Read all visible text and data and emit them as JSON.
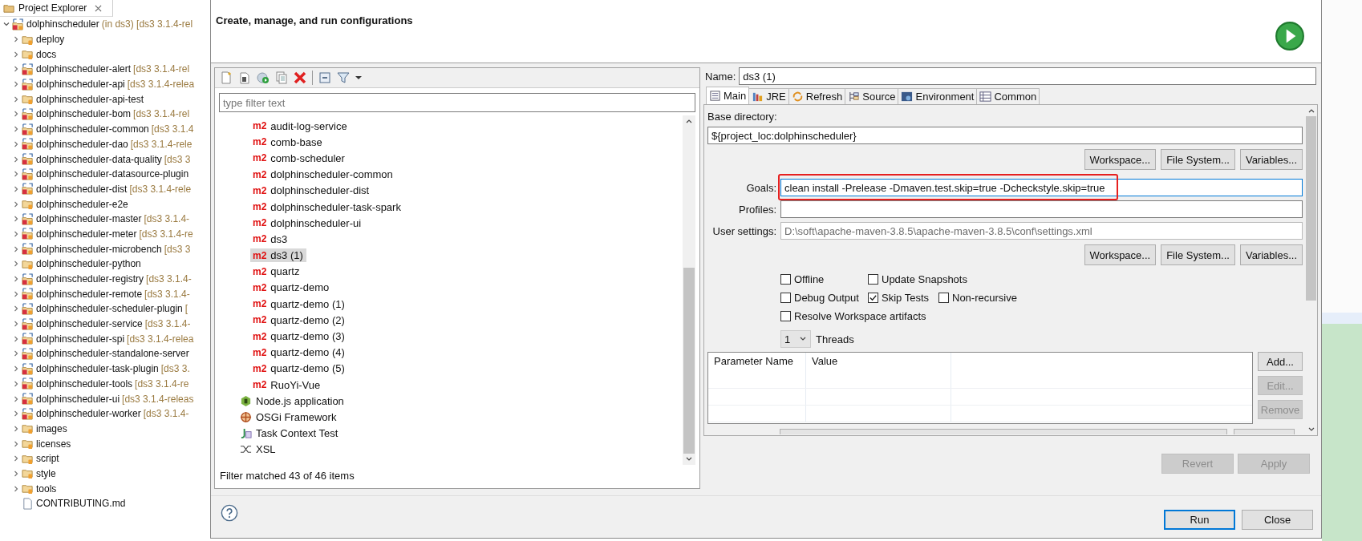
{
  "explorer": {
    "title": "Project Explorer",
    "tree": [
      {
        "name": "dolphinscheduler",
        "decoration": "(in ds3) [ds3 3.1.4-rel",
        "kind": "project",
        "expanded": true,
        "children": [
          {
            "name": "deploy",
            "kind": "folder",
            "expanded": false
          },
          {
            "name": "docs",
            "kind": "folder",
            "expanded": false
          },
          {
            "name": "dolphinscheduler-alert",
            "decoration": "[ds3 3.1.4-rel",
            "kind": "project",
            "expanded": false
          },
          {
            "name": "dolphinscheduler-api",
            "decoration": "[ds3 3.1.4-relea",
            "kind": "project",
            "expanded": false
          },
          {
            "name": "dolphinscheduler-api-test",
            "kind": "folder",
            "expanded": false
          },
          {
            "name": "dolphinscheduler-bom",
            "decoration": "[ds3 3.1.4-rel",
            "kind": "project",
            "expanded": false
          },
          {
            "name": "dolphinscheduler-common",
            "decoration": "[ds3 3.1.4",
            "kind": "project",
            "expanded": false
          },
          {
            "name": "dolphinscheduler-dao",
            "decoration": "[ds3 3.1.4-rele",
            "kind": "project",
            "expanded": false
          },
          {
            "name": "dolphinscheduler-data-quality",
            "decoration": "[ds3 3",
            "kind": "project",
            "expanded": false
          },
          {
            "name": "dolphinscheduler-datasource-plugin",
            "kind": "project",
            "expanded": false
          },
          {
            "name": "dolphinscheduler-dist",
            "decoration": "[ds3 3.1.4-rele",
            "kind": "project",
            "expanded": false
          },
          {
            "name": "dolphinscheduler-e2e",
            "kind": "folder",
            "expanded": false
          },
          {
            "name": "dolphinscheduler-master",
            "decoration": "[ds3 3.1.4-",
            "kind": "project",
            "expanded": false
          },
          {
            "name": "dolphinscheduler-meter",
            "decoration": "[ds3 3.1.4-re",
            "kind": "project",
            "expanded": false
          },
          {
            "name": "dolphinscheduler-microbench",
            "decoration": "[ds3 3",
            "kind": "project",
            "expanded": false
          },
          {
            "name": "dolphinscheduler-python",
            "kind": "folder",
            "expanded": false
          },
          {
            "name": "dolphinscheduler-registry",
            "decoration": "[ds3 3.1.4-",
            "kind": "project",
            "expanded": false
          },
          {
            "name": "dolphinscheduler-remote",
            "decoration": "[ds3 3.1.4-",
            "kind": "project",
            "expanded": false
          },
          {
            "name": "dolphinscheduler-scheduler-plugin",
            "decoration": "[",
            "kind": "project",
            "expanded": false
          },
          {
            "name": "dolphinscheduler-service",
            "decoration": "[ds3 3.1.4-",
            "kind": "project",
            "expanded": false
          },
          {
            "name": "dolphinscheduler-spi",
            "decoration": "[ds3 3.1.4-relea",
            "kind": "project",
            "expanded": false
          },
          {
            "name": "dolphinscheduler-standalone-server",
            "kind": "project",
            "expanded": false
          },
          {
            "name": "dolphinscheduler-task-plugin",
            "decoration": "[ds3 3.",
            "kind": "project",
            "expanded": false
          },
          {
            "name": "dolphinscheduler-tools",
            "decoration": "[ds3 3.1.4-re",
            "kind": "project",
            "expanded": false
          },
          {
            "name": "dolphinscheduler-ui",
            "decoration": "[ds3 3.1.4-releas",
            "kind": "project",
            "expanded": false
          },
          {
            "name": "dolphinscheduler-worker",
            "decoration": "[ds3 3.1.4-",
            "kind": "project",
            "expanded": false
          },
          {
            "name": "images",
            "kind": "folder",
            "expanded": false
          },
          {
            "name": "licenses",
            "kind": "folder",
            "expanded": false
          },
          {
            "name": "script",
            "kind": "folder",
            "expanded": false
          },
          {
            "name": "style",
            "kind": "folder",
            "expanded": false
          },
          {
            "name": "tools",
            "kind": "folder",
            "expanded": false
          },
          {
            "name": "CONTRIBUTING.md",
            "kind": "file"
          }
        ]
      }
    ]
  },
  "dialog": {
    "heading": "Create, manage, and run configurations",
    "filter": {
      "placeholder": "type filter text"
    },
    "launch_tree": [
      {
        "children": [
          {
            "badge": "m2",
            "label": "audit-log-service",
            "selected": false
          },
          {
            "badge": "m2",
            "label": "comb-base",
            "selected": false
          },
          {
            "badge": "m2",
            "label": "comb-scheduler",
            "selected": false
          },
          {
            "badge": "m2",
            "label": "dolphinscheduler-common",
            "selected": false
          },
          {
            "badge": "m2",
            "label": "dolphinscheduler-dist",
            "selected": false
          },
          {
            "badge": "m2",
            "label": "dolphinscheduler-task-spark",
            "selected": false
          },
          {
            "badge": "m2",
            "label": "dolphinscheduler-ui",
            "selected": false
          },
          {
            "badge": "m2",
            "label": "ds3",
            "selected": false
          },
          {
            "badge": "m2",
            "label": "ds3 (1)",
            "selected": true
          },
          {
            "badge": "m2",
            "label": "quartz",
            "selected": false
          },
          {
            "badge": "m2",
            "label": "quartz-demo",
            "selected": false
          },
          {
            "badge": "m2",
            "label": "quartz-demo (1)",
            "selected": false
          },
          {
            "badge": "m2",
            "label": "quartz-demo (2)",
            "selected": false
          },
          {
            "badge": "m2",
            "label": "quartz-demo (3)",
            "selected": false
          },
          {
            "badge": "m2",
            "label": "quartz-demo (4)",
            "selected": false
          },
          {
            "badge": "m2",
            "label": "quartz-demo (5)",
            "selected": false
          },
          {
            "badge": "m2",
            "label": "RuoYi-Vue",
            "selected": false
          }
        ]
      },
      {
        "label": "Node.js application",
        "kind": "nodejs",
        "selected": false
      },
      {
        "label": "OSGi Framework",
        "kind": "osgi",
        "selected": false
      },
      {
        "label": "Task Context Test",
        "kind": "junit",
        "selected": false
      },
      {
        "label": "XSL",
        "kind": "xsl",
        "selected": false
      }
    ],
    "filter_status": "Filter matched 43 of 46 items",
    "config": {
      "name_label": "Name:",
      "name": "ds3 (1)",
      "tabs": [
        {
          "label": "Main",
          "kind": "main",
          "selected": true
        },
        {
          "label": "JRE",
          "kind": "jre",
          "selected": false
        },
        {
          "label": "Refresh",
          "kind": "refresh",
          "selected": false
        },
        {
          "label": "Source",
          "kind": "source",
          "selected": false
        },
        {
          "label": "Environment",
          "kind": "environment",
          "selected": false
        },
        {
          "label": "Common",
          "kind": "common",
          "selected": false
        }
      ],
      "base_directory": {
        "label": "Base directory:",
        "value": "${project_loc:dolphinscheduler}"
      },
      "buttons_1": [
        "Workspace...",
        "File System...",
        "Variables..."
      ],
      "goals": {
        "label": "Goals:",
        "value": "clean install -Prelease -Dmaven.test.skip=true -Dcheckstyle.skip=true",
        "highlighted": true
      },
      "profiles": {
        "label": "Profiles:"
      },
      "user_settings": {
        "label": "User settings:",
        "value": "D:\\soft\\apache-maven-3.8.5\\apache-maven-3.8.5\\conf\\settings.xml",
        "disabled": true
      },
      "buttons_2": [
        "Workspace...",
        "File System...",
        "Variables..."
      ],
      "options": [
        [
          {
            "label": "Offline",
            "checked": false
          },
          {
            "label": "Update Snapshots",
            "checked": false
          }
        ],
        [
          {
            "label": "Debug Output",
            "checked": false
          },
          {
            "label": "Skip Tests",
            "checked": true
          },
          {
            "label": "Non-recursive",
            "checked": false
          }
        ],
        [
          {
            "label": "Resolve Workspace artifacts",
            "checked": false
          }
        ]
      ],
      "threads": {
        "value": "1",
        "label": "Threads"
      },
      "parameters": {
        "columns": [
          "Parameter Name",
          "Value"
        ]
      },
      "parameter_buttons": [
        {
          "label": "Add...",
          "disabled": false
        },
        {
          "label": "Edit...",
          "disabled": true
        },
        {
          "label": "Remove",
          "disabled": true
        }
      ],
      "actions": [
        {
          "label": "Revert",
          "disabled": true
        },
        {
          "label": "Apply",
          "disabled": true
        }
      ]
    },
    "footer_buttons": [
      {
        "label": "Run",
        "default": true
      },
      {
        "label": "Close",
        "default": false
      }
    ]
  }
}
